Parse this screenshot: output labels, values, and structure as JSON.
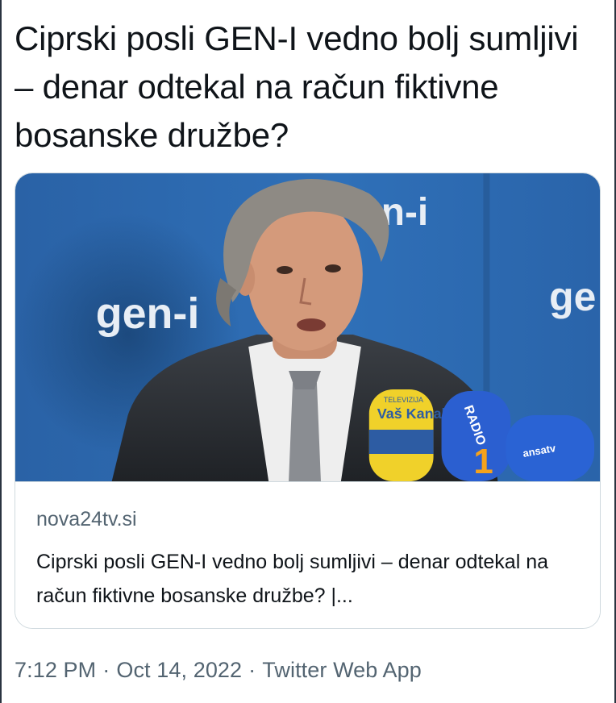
{
  "tweet": {
    "text": "Ciprski posli GEN-I vedno bolj sumljivi – denar odtekal na račun fiktivne bosanske družbe?"
  },
  "card": {
    "image_alt": "Man speaking into microphones in front of gen-i logo backdrop",
    "image_text": {
      "logo_left": "gen-i",
      "logo_top": "n-i",
      "logo_right": "ge",
      "mic_yellow": "Vaš Kanal",
      "mic_yellow_small": "TELEVIZIJA",
      "mic_blue": "RADIO",
      "mic_blue_number": "1",
      "mic_right": "ansatv"
    },
    "domain": "nova24tv.si",
    "title": "Ciprski posli GEN-I vedno bolj sumljivi – denar odtekal na račun fiktivne bosanske družbe? |..."
  },
  "meta": {
    "time": "7:12 PM",
    "separator": "·",
    "date": "Oct 14, 2022",
    "source": "Twitter Web App"
  },
  "colors": {
    "text": "#0f1419",
    "secondary": "#536471",
    "border": "#cfd9de",
    "backdrop_blue": "#2f6fb5"
  }
}
